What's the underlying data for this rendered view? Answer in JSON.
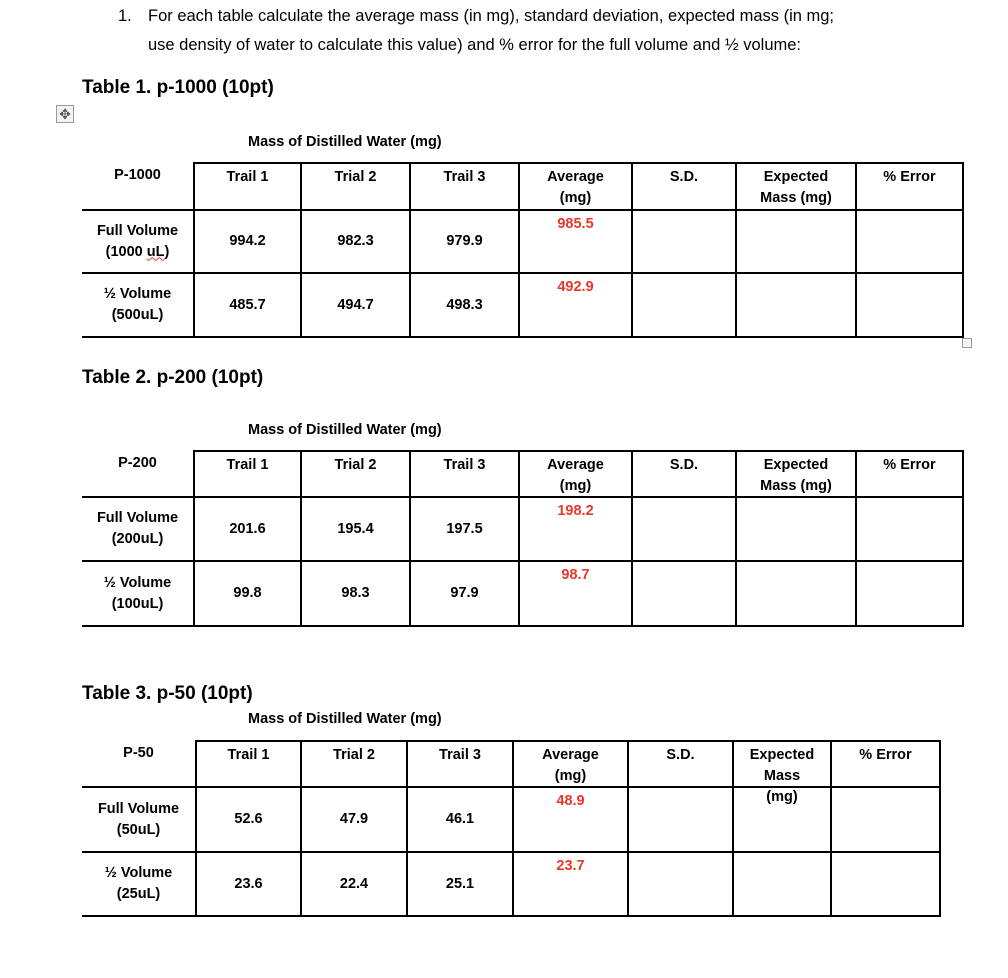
{
  "instruction": {
    "number": "1.",
    "line1": "For each table calculate the average mass (in mg), standard deviation, expected mass (in mg;",
    "line2": "use density of water to calculate this value) and % error for the full volume and ½ volume:"
  },
  "icons": {
    "move_handle": "✥"
  },
  "tables": [
    {
      "title": "Table 1. p-1000 (10pt)",
      "caption": "Mass of Distilled Water (mg)",
      "corner": "P-1000",
      "headers": [
        "Trail 1",
        "Trial 2",
        "Trail 3",
        "Average (mg)",
        "S.D.",
        "Expected Mass (mg)",
        "% Error"
      ],
      "rows": [
        {
          "label1": "Full Volume",
          "label2": "(1000 uL)",
          "values": [
            "994.2",
            "982.3",
            "979.9"
          ],
          "average": "985.5",
          "sd": "",
          "expected": "",
          "error": ""
        },
        {
          "label1": "½ Volume",
          "label2": "(500uL)",
          "values": [
            "485.7",
            "494.7",
            "498.3"
          ],
          "average": "492.9",
          "sd": "",
          "expected": "",
          "error": ""
        }
      ]
    },
    {
      "title": "Table 2. p-200 (10pt)",
      "caption": "Mass of Distilled Water (mg)",
      "corner": "P-200",
      "headers": [
        "Trail 1",
        "Trial 2",
        "Trail 3",
        "Average (mg)",
        "S.D.",
        "Expected Mass (mg)",
        "% Error"
      ],
      "rows": [
        {
          "label1": "Full Volume",
          "label2": "(200uL)",
          "values": [
            "201.6",
            "195.4",
            "197.5"
          ],
          "average": "198.2",
          "sd": "",
          "expected": "",
          "error": ""
        },
        {
          "label1": "½ Volume",
          "label2": "(100uL)",
          "values": [
            "99.8",
            "98.3",
            "97.9"
          ],
          "average": "98.7",
          "sd": "",
          "expected": "",
          "error": ""
        }
      ]
    },
    {
      "title": "Table 3. p-50 (10pt)",
      "caption": "Mass of Distilled Water (mg)",
      "corner": "P-50",
      "headers": [
        "Trail 1",
        "Trial 2",
        "Trail 3",
        "Average (mg)",
        "S.D.",
        "Expected Mass (mg)",
        "% Error"
      ],
      "rows": [
        {
          "label1": "Full Volume",
          "label2": "(50uL)",
          "values": [
            "52.6",
            "47.9",
            "46.1"
          ],
          "average": "48.9",
          "sd": "",
          "expected": "",
          "error": ""
        },
        {
          "label1": "½ Volume",
          "label2": "(25uL)",
          "values": [
            "23.6",
            "22.4",
            "25.1"
          ],
          "average": "23.7",
          "sd": "",
          "expected": "",
          "error": ""
        }
      ]
    }
  ],
  "colors": {
    "average_text": "#e8382a"
  }
}
